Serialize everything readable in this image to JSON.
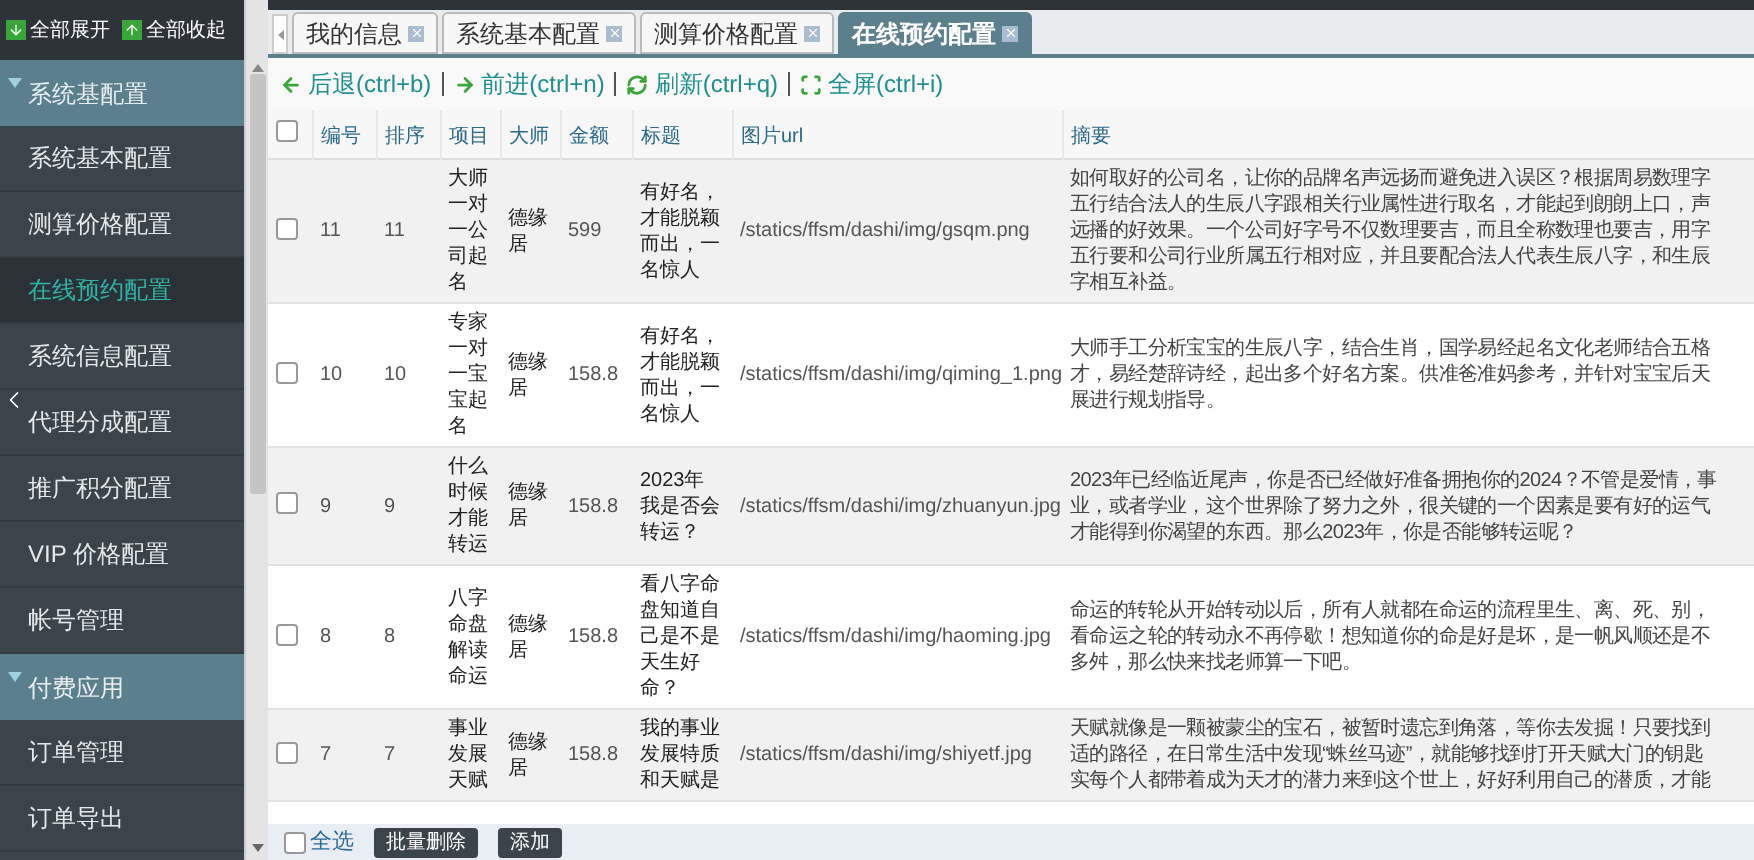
{
  "top_actions": {
    "expand_all": "全部展开",
    "collapse_all": "全部收起"
  },
  "sidebar": {
    "groups": [
      {
        "label": "系统基配置",
        "expanded": true,
        "items": [
          {
            "label": "系统基本配置",
            "selected": false
          },
          {
            "label": "测算价格配置",
            "selected": false
          },
          {
            "label": "在线预约配置",
            "selected": true
          },
          {
            "label": "系统信息配置",
            "selected": false
          },
          {
            "label": "代理分成配置",
            "selected": false
          },
          {
            "label": "推广积分配置",
            "selected": false
          },
          {
            "label": "VIP 价格配置",
            "selected": false
          },
          {
            "label": "帐号管理",
            "selected": false
          }
        ]
      },
      {
        "label": "付费应用",
        "expanded": true,
        "items": [
          {
            "label": "订单管理",
            "selected": false
          },
          {
            "label": "订单导出",
            "selected": false
          }
        ]
      }
    ]
  },
  "tabs": [
    {
      "label": "我的信息",
      "selected": false
    },
    {
      "label": "系统基本配置",
      "selected": false
    },
    {
      "label": "测算价格配置",
      "selected": false
    },
    {
      "label": "在线预约配置",
      "selected": true
    }
  ],
  "nav": [
    {
      "kind": "back",
      "label": "后退(ctrl+b)"
    },
    {
      "kind": "forward",
      "label": "前进(ctrl+n)"
    },
    {
      "kind": "refresh",
      "label": "刷新(ctrl+q)"
    },
    {
      "kind": "fullscreen",
      "label": "全屏(ctrl+i)"
    }
  ],
  "table": {
    "header_checked": false,
    "columns": [
      "编号",
      "排序",
      "项目",
      "大师",
      "金额",
      "标题",
      "图片url",
      "摘要"
    ],
    "rows": [
      {
        "checked": false,
        "id": "11",
        "order": "11",
        "project": "大师一对一公司起名",
        "master": "德缘居",
        "amount": "599",
        "title": "有好名，才能脱颖而出，一名惊人",
        "image_url": "/statics/ffsm/dashi/img/gsqm.png",
        "summary": [
          "如何取好的公司名，让你的品牌名声远扬而避免进入误区？根据周易数理字",
          "五行结合法人的生辰八字跟相关行业属性进行取名，才能起到朗朗上口，声",
          "远播的好效果。一个公司好字号不仅数理要吉，而且全称数理也要吉，用字",
          "五行要和公司行业所属五行相对应，并且要配合法人代表生辰八字，和生辰",
          "字相互补益。"
        ]
      },
      {
        "checked": false,
        "id": "10",
        "order": "10",
        "project": "专家一对一宝宝起名",
        "master": "德缘居",
        "amount": "158.8",
        "title": "有好名，才能脱颖而出，一名惊人",
        "image_url": "/statics/ffsm/dashi/img/qiming_1.png",
        "summary": [
          "大师手工分析宝宝的生辰八字，结合生肖，国学易经起名文化老师结合五格",
          "才，易经楚辞诗经，起出多个好名方案。供准爸准妈参考，并针对宝宝后天",
          "展进行规划指导。"
        ]
      },
      {
        "checked": false,
        "id": "9",
        "order": "9",
        "project": "什么时候才能转运",
        "master": "德缘居",
        "amount": "158.8",
        "title": "2023年我是否会转运？",
        "image_url": "/statics/ffsm/dashi/img/zhuanyun.jpg",
        "summary": [
          "2023年已经临近尾声，你是否已经做好准备拥抱你的2024？不管是爱情，事",
          "业，或者学业，这个世界除了努力之外，很关键的一个因素是要有好的运气",
          "才能得到你渴望的东西。那么2023年，你是否能够转运呢？"
        ]
      },
      {
        "checked": false,
        "id": "8",
        "order": "8",
        "project": "八字命盘解读命运",
        "master": "德缘居",
        "amount": "158.8",
        "title": "看八字命盘知道自己是不是天生好命？",
        "image_url": "/statics/ffsm/dashi/img/haoming.jpg",
        "summary": [
          "命运的转轮从开始转动以后，所有人就都在命运的流程里生、离、死、别，",
          "看命运之轮的转动永不再停歇！想知道你的命是好是坏，是一帆风顺还是不",
          "多舛，那么快来找老师算一下吧。"
        ]
      },
      {
        "checked": false,
        "id": "7",
        "order": "7",
        "project": "事业发展天赋",
        "master": "德缘居",
        "amount": "158.8",
        "title": "我的事业发展特质和天赋是",
        "image_url": "/statics/ffsm/dashi/img/shiyetf.jpg",
        "summary": [
          "天赋就像是一颗被蒙尘的宝石，被暂时遗忘到角落，等你去发掘！只要找到",
          "适的路径，在日常生活中发现“蛛丝马迹”，就能够找到打开天赋大门的钥匙",
          "实每个人都带着成为天才的潜力来到这个世上，好好利用自己的潜质，才能"
        ]
      }
    ]
  },
  "footer": {
    "select_all": "全选",
    "select_all_checked": false,
    "buttons": [
      "批量删除",
      "添加"
    ]
  }
}
